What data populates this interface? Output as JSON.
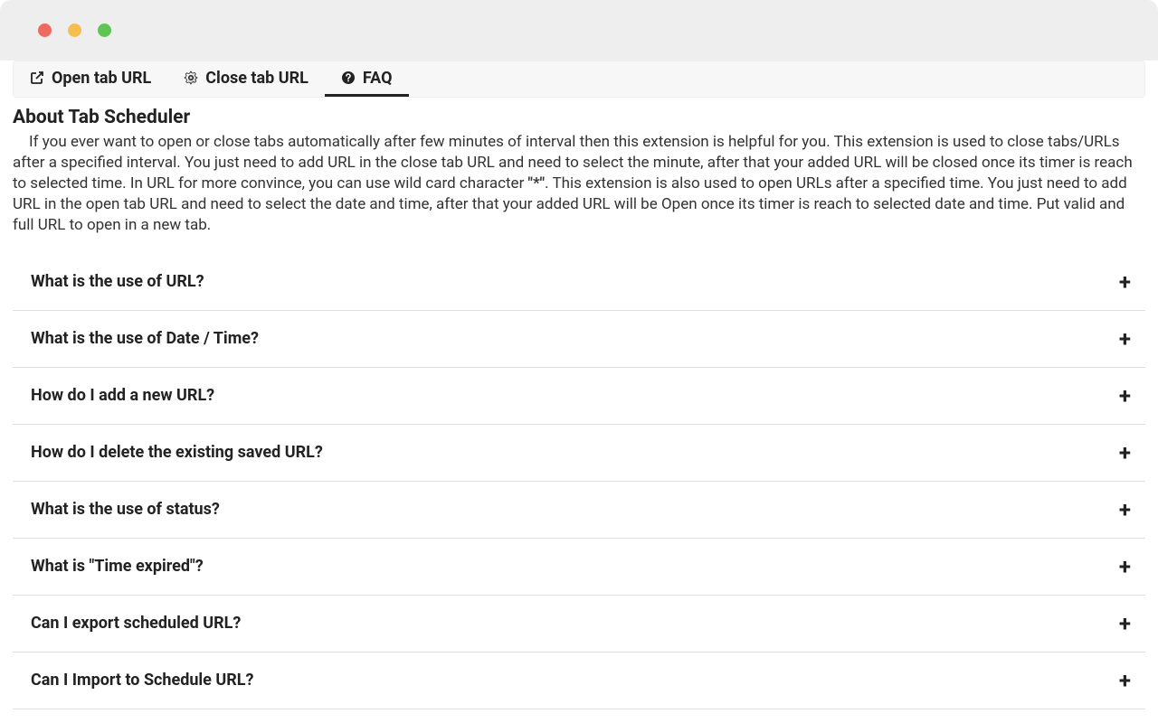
{
  "tabs": [
    {
      "label": "Open tab URL"
    },
    {
      "label": "Close tab URL"
    },
    {
      "label": "FAQ"
    }
  ],
  "about": {
    "title": "About Tab Scheduler",
    "text_part1": "If you ever want to open or close tabs automatically after few minutes of interval then this extension is helpful for you. This extension is used to close tabs/URLs after a specified interval. You just need to add URL in the close tab URL and need to select the minute, after that your added URL will be closed once its timer is reach to selected time. In URL for more convince, you can use wild card character ",
    "text_bold": "\"*\"",
    "text_part2": ". This extension is also used to open URLs after a specified time. You just need to add URL in the open tab URL and need to select the date and time, after that your added URL will be Open once its timer is reach to selected date and time. Put valid and full URL to open in a new tab."
  },
  "faq": [
    {
      "question": "What is the use of URL?"
    },
    {
      "question": "What is the use of Date / Time?"
    },
    {
      "question": "How do I add a new URL?"
    },
    {
      "question": "How do I delete the existing saved URL?"
    },
    {
      "question": "What is the use of status?"
    },
    {
      "question": "What is \"Time expired\"?"
    },
    {
      "question": "Can I export scheduled URL?"
    },
    {
      "question": "Can I Import to Schedule URL?"
    }
  ]
}
